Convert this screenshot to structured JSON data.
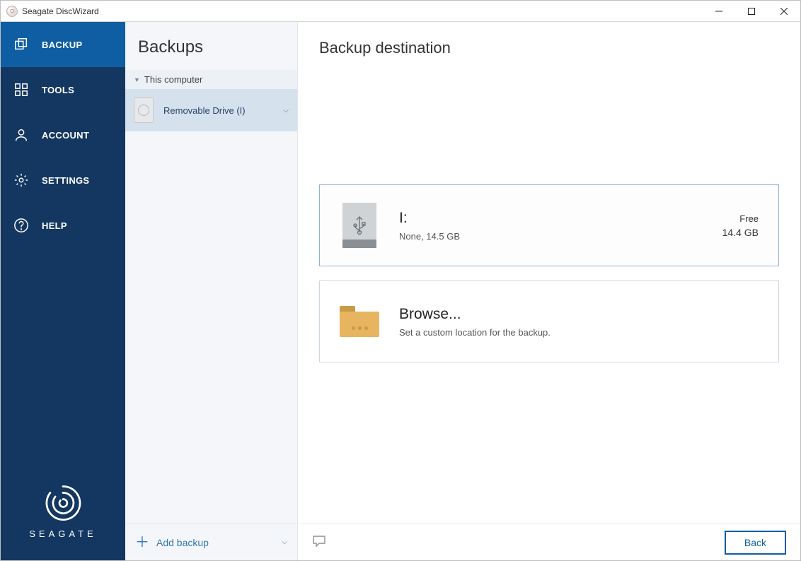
{
  "window": {
    "title": "Seagate DiscWizard"
  },
  "sidebar": {
    "items": [
      {
        "label": "BACKUP"
      },
      {
        "label": "TOOLS"
      },
      {
        "label": "ACCOUNT"
      },
      {
        "label": "SETTINGS"
      },
      {
        "label": "HELP"
      }
    ],
    "brand": "SEAGATE"
  },
  "mid": {
    "title": "Backups",
    "group_label": "This computer",
    "items": [
      {
        "label": "Removable Drive (I)"
      }
    ],
    "add_label": "Add backup"
  },
  "main": {
    "title": "Backup destination",
    "drive": {
      "title": "I:",
      "subtitle": "None, 14.5 GB",
      "free_label": "Free",
      "free_value": "14.4 GB"
    },
    "browse": {
      "title": "Browse...",
      "subtitle": "Set a custom location for the backup."
    },
    "back_label": "Back"
  }
}
